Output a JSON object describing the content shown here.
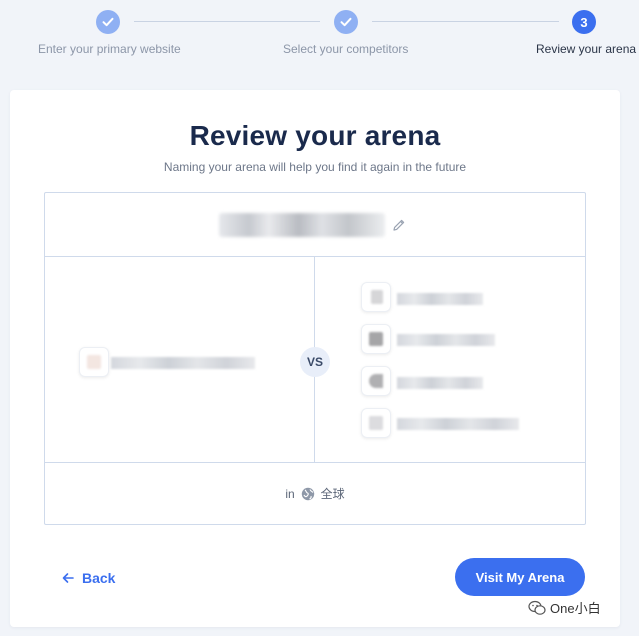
{
  "stepper": {
    "steps": [
      {
        "label": "Enter your primary website",
        "state": "done",
        "number": "1"
      },
      {
        "label": "Select your competitors",
        "state": "done",
        "number": "2"
      },
      {
        "label": "Review your arena",
        "state": "active",
        "number": "3"
      }
    ]
  },
  "card": {
    "title": "Review your arena",
    "subtitle": "Naming your arena will help you find it again in the future",
    "vs_label": "VS",
    "region_prefix": "in",
    "region_name": "全球",
    "back_label": "Back",
    "visit_label": "Visit My Arena"
  },
  "icons": {
    "check": "check-icon",
    "edit": "pencil-icon",
    "globe": "globe-icon",
    "back": "arrow-left-icon"
  },
  "colors": {
    "accent": "#3b6fef",
    "done_step": "#8fb0f3",
    "border": "#cfdaeb",
    "page_bg": "#f1f4f9"
  },
  "watermark": {
    "text": "One小白"
  }
}
